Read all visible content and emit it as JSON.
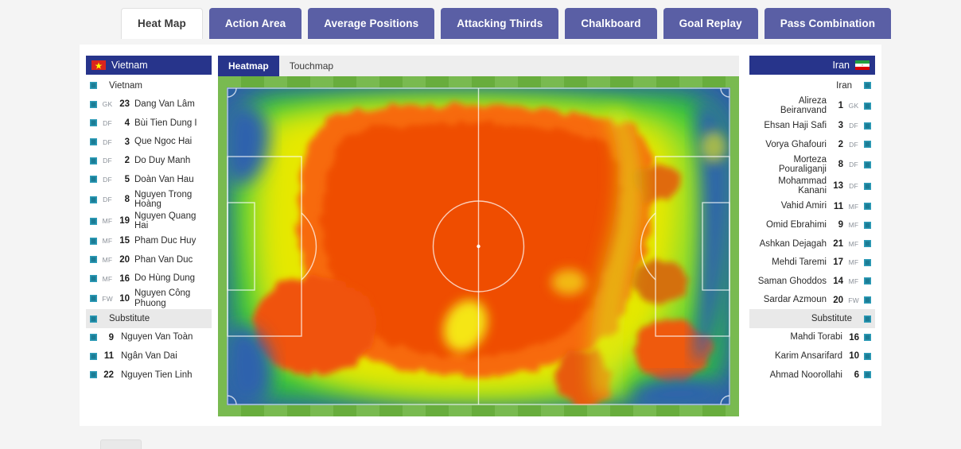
{
  "top_tabs": [
    {
      "label": "Heat Map",
      "active": true
    },
    {
      "label": "Action Area",
      "active": false
    },
    {
      "label": "Average Positions",
      "active": false
    },
    {
      "label": "Attacking Thirds",
      "active": false
    },
    {
      "label": "Chalkboard",
      "active": false
    },
    {
      "label": "Goal Replay",
      "active": false
    },
    {
      "label": "Pass Combination",
      "active": false
    }
  ],
  "map_tabs": [
    {
      "label": "Heatmap",
      "active": true
    },
    {
      "label": "Touchmap",
      "active": false
    }
  ],
  "colors": {
    "tab_inactive_bg": "#5a5fa5",
    "tab_active_bg": "#ffffff",
    "team_header_bg": "#27348b",
    "checkbox": "#1b7c95",
    "substitute_row_bg": "#e9e9e9",
    "pitch_green": "#6cb33f",
    "page_bg": "#f4f4f4"
  },
  "home_team": {
    "name": "Vietnam",
    "flag": "vietnam-flag",
    "team_row_label": "Vietnam",
    "substitute_label": "Substitute",
    "starters": [
      {
        "pos": "GK",
        "num": "23",
        "name": "Dang Van Lâm"
      },
      {
        "pos": "DF",
        "num": "4",
        "name": "Bùi Tien Dung I"
      },
      {
        "pos": "DF",
        "num": "3",
        "name": "Que Ngoc Hai"
      },
      {
        "pos": "DF",
        "num": "2",
        "name": "Do Duy Manh"
      },
      {
        "pos": "DF",
        "num": "5",
        "name": "Doàn Van Hau"
      },
      {
        "pos": "DF",
        "num": "8",
        "name": "Nguyen Trong Hoàng"
      },
      {
        "pos": "MF",
        "num": "19",
        "name": "Nguyen Quang Hai"
      },
      {
        "pos": "MF",
        "num": "15",
        "name": "Pham Duc Huy"
      },
      {
        "pos": "MF",
        "num": "20",
        "name": "Phan Van Duc"
      },
      {
        "pos": "MF",
        "num": "16",
        "name": "Do Hùng Dung"
      },
      {
        "pos": "FW",
        "num": "10",
        "name": "Nguyen Công Phuong"
      }
    ],
    "substitutes": [
      {
        "pos": "",
        "num": "9",
        "name": "Nguyen Van Toàn"
      },
      {
        "pos": "",
        "num": "11",
        "name": "Ngân Van Dai"
      },
      {
        "pos": "",
        "num": "22",
        "name": "Nguyen Tien Linh"
      }
    ]
  },
  "away_team": {
    "name": "Iran",
    "flag": "iran-flag",
    "team_row_label": "Iran",
    "substitute_label": "Substitute",
    "starters": [
      {
        "pos": "GK",
        "num": "1",
        "name": "Alireza Beiranvand"
      },
      {
        "pos": "DF",
        "num": "3",
        "name": "Ehsan Haji Safi"
      },
      {
        "pos": "DF",
        "num": "2",
        "name": "Vorya Ghafouri"
      },
      {
        "pos": "DF",
        "num": "8",
        "name": "Morteza Pouraliganji"
      },
      {
        "pos": "DF",
        "num": "13",
        "name": "Mohammad Kanani"
      },
      {
        "pos": "MF",
        "num": "11",
        "name": "Vahid Amiri"
      },
      {
        "pos": "MF",
        "num": "9",
        "name": "Omid Ebrahimi"
      },
      {
        "pos": "MF",
        "num": "21",
        "name": "Ashkan Dejagah"
      },
      {
        "pos": "MF",
        "num": "17",
        "name": "Mehdi Taremi"
      },
      {
        "pos": "MF",
        "num": "14",
        "name": "Saman Ghoddos"
      },
      {
        "pos": "FW",
        "num": "20",
        "name": "Sardar Azmoun"
      }
    ],
    "substitutes": [
      {
        "pos": "",
        "num": "16",
        "name": "Mahdi Torabi"
      },
      {
        "pos": "",
        "num": "10",
        "name": "Karim Ansarifard"
      },
      {
        "pos": "",
        "num": "6",
        "name": "Ahmad Noorollahi"
      }
    ]
  }
}
